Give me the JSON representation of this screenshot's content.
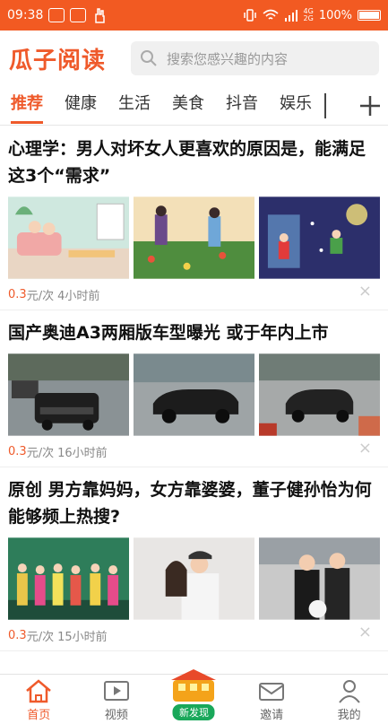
{
  "status_bar": {
    "time": "09:38",
    "battery": "100%",
    "net_top": "4G",
    "net_bottom": "2G"
  },
  "header": {
    "logo": "瓜子阅读",
    "search_placeholder": "搜索您感兴趣的内容"
  },
  "tabs": [
    {
      "label": "推荐",
      "active": true
    },
    {
      "label": "健康"
    },
    {
      "label": "生活"
    },
    {
      "label": "美食"
    },
    {
      "label": "抖音"
    },
    {
      "label": "娱乐"
    }
  ],
  "articles": [
    {
      "title": "心理学：男人对坏女人更喜欢的原因是，能满足这3个“需求”",
      "price": "0.3",
      "price_unit": "元/次",
      "time": "4小时前"
    },
    {
      "title": "国产奥迪A3两厢版车型曝光 或于年内上市",
      "price": "0.3",
      "price_unit": "元/次",
      "time": "16小时前"
    },
    {
      "title": "原创 男方靠妈妈，女方靠婆婆，董子健孙怡为何能够频上热搜?",
      "price": "0.3",
      "price_unit": "元/次",
      "time": "15小时前"
    }
  ],
  "close_glyph": "×",
  "bottom_nav": [
    {
      "label": "首页",
      "icon": "home-icon",
      "active": true
    },
    {
      "label": "视频",
      "icon": "video-icon"
    },
    {
      "label": "新发现",
      "icon": "discover-icon"
    },
    {
      "label": "邀请",
      "icon": "mail-icon"
    },
    {
      "label": "我的",
      "icon": "profile-icon"
    }
  ],
  "colors": {
    "brand": "#ef5a2b",
    "status_bar": "#f25a22",
    "discover_green": "#19a85a"
  }
}
